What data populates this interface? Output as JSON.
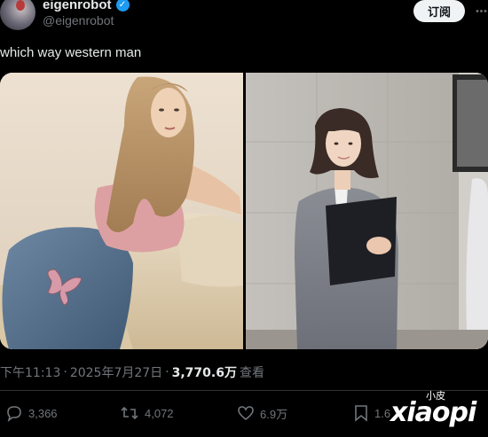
{
  "author": {
    "display_name": "eigenrobot",
    "handle": "@eigenrobot",
    "verified": true
  },
  "header": {
    "subscribe_label": "订阅"
  },
  "tweet": {
    "text": "which way western man",
    "meta": {
      "time": "下午11:13",
      "separator_1": "·",
      "date": "2025年7月27日",
      "separator_2": "·",
      "views_count": "3,770.6万",
      "views_label": "查看"
    }
  },
  "media": {
    "count": 2
  },
  "actions": {
    "replies": "3,366",
    "retweets": "4,072",
    "likes": "6.9万",
    "bookmarks": "1.6"
  },
  "watermark": {
    "small": "小皮",
    "large": "xiaopi"
  },
  "colors": {
    "background": "#000000",
    "text": "#e7e9ea",
    "secondary": "#71767b",
    "verified_blue": "#1d9bf0",
    "button_bg": "#eff3f4"
  },
  "icons": [
    "verified-badge-icon",
    "more-options-icon",
    "reply-icon",
    "retweet-icon",
    "like-icon",
    "bookmark-icon"
  ]
}
